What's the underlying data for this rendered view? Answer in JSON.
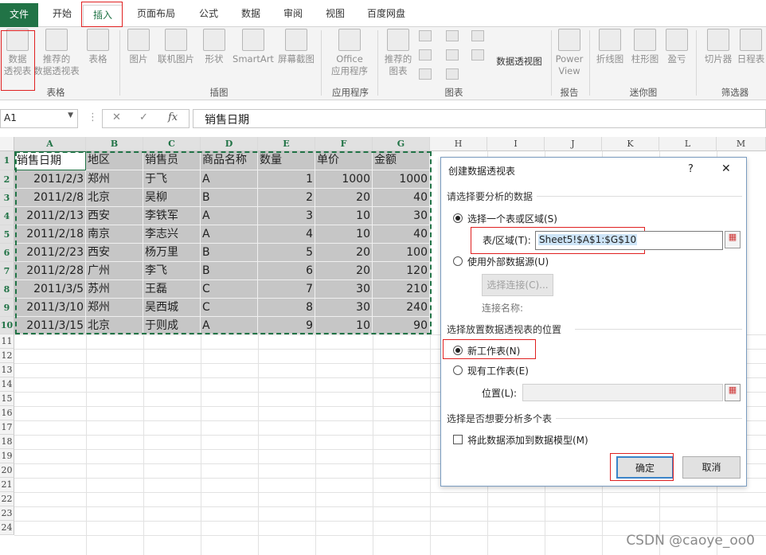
{
  "tabs": {
    "file": "文件",
    "home": "开始",
    "insert": "插入",
    "layout": "页面布局",
    "formulas": "公式",
    "data": "数据",
    "review": "审阅",
    "view": "视图",
    "baidu": "百度网盘"
  },
  "ribbon": {
    "pivot_table": [
      "数据",
      "透视表"
    ],
    "recommended_pivot": [
      "推荐的",
      "数据透视表"
    ],
    "table": "表格",
    "group_tables": "表格",
    "picture": "图片",
    "online_picture": "联机图片",
    "shapes": "形状",
    "smartart": "SmartArt",
    "screenshot": "屏幕截图",
    "group_illustrations": "插图",
    "office_apps": [
      "Office",
      "应用程序"
    ],
    "group_apps": "应用程序",
    "recommended_charts": [
      "推荐的",
      "图表"
    ],
    "pivot_chart": "数据透视图",
    "group_charts": "图表",
    "power_view": [
      "Power",
      "View"
    ],
    "group_reports": "报告",
    "sparkline_line": "折线图",
    "sparkline_column": "柱形图",
    "sparkline_winloss": "盈亏",
    "group_sparklines": "迷你图",
    "slicer": "切片器",
    "timeline": "日程表",
    "group_filters": "筛选器"
  },
  "formula_bar": {
    "name_box": "A1",
    "cancel": "✕",
    "enter": "✓",
    "fx": "fx",
    "formula": "销售日期"
  },
  "columns": [
    "A",
    "B",
    "C",
    "D",
    "E",
    "F",
    "G",
    "H",
    "I",
    "J",
    "K",
    "L",
    "M"
  ],
  "rows": [
    "1",
    "2",
    "3",
    "4",
    "5",
    "6",
    "7",
    "8",
    "9",
    "10",
    "11",
    "12",
    "13",
    "14",
    "15",
    "16",
    "17",
    "18",
    "19",
    "20",
    "21",
    "22",
    "23",
    "24"
  ],
  "table": {
    "headers": [
      "销售日期",
      "地区",
      "销售员",
      "商品名称",
      "数量",
      "单价",
      "金额"
    ],
    "rows": [
      [
        "2011/2/3",
        "郑州",
        "于飞",
        "A",
        "1",
        "1000",
        "1000"
      ],
      [
        "2011/2/8",
        "北京",
        "吴柳",
        "B",
        "2",
        "20",
        "40"
      ],
      [
        "2011/2/13",
        "西安",
        "李铁军",
        "A",
        "3",
        "10",
        "30"
      ],
      [
        "2011/2/18",
        "南京",
        "李志兴",
        "A",
        "4",
        "10",
        "40"
      ],
      [
        "2011/2/23",
        "西安",
        "杨万里",
        "B",
        "5",
        "20",
        "100"
      ],
      [
        "2011/2/28",
        "广州",
        "李飞",
        "B",
        "6",
        "20",
        "120"
      ],
      [
        "2011/3/5",
        "苏州",
        "王磊",
        "C",
        "7",
        "30",
        "210"
      ],
      [
        "2011/3/10",
        "郑州",
        "吴西城",
        "C",
        "8",
        "30",
        "240"
      ],
      [
        "2011/3/15",
        "北京",
        "于则成",
        "A",
        "9",
        "10",
        "90"
      ]
    ]
  },
  "dialog": {
    "title": "创建数据透视表",
    "help": "?",
    "close": "✕",
    "section_choose": "请选择要分析的数据",
    "opt_range": "选择一个表或区域(S)",
    "range_label": "表/区域(T):",
    "range_value": "Sheet5!$A$1:$G$10",
    "opt_external": "使用外部数据源(U)",
    "choose_connection": "选择连接(C)...",
    "connection_name": "连接名称:",
    "section_place": "选择放置数据透视表的位置",
    "opt_new_sheet": "新工作表(N)",
    "opt_existing": "现有工作表(E)",
    "location_label": "位置(L):",
    "section_multi": "选择是否想要分析多个表",
    "add_model": "将此数据添加到数据模型(M)",
    "ok": "确定",
    "cancel": "取消"
  },
  "watermark": "CSDN @caoye_oo0"
}
